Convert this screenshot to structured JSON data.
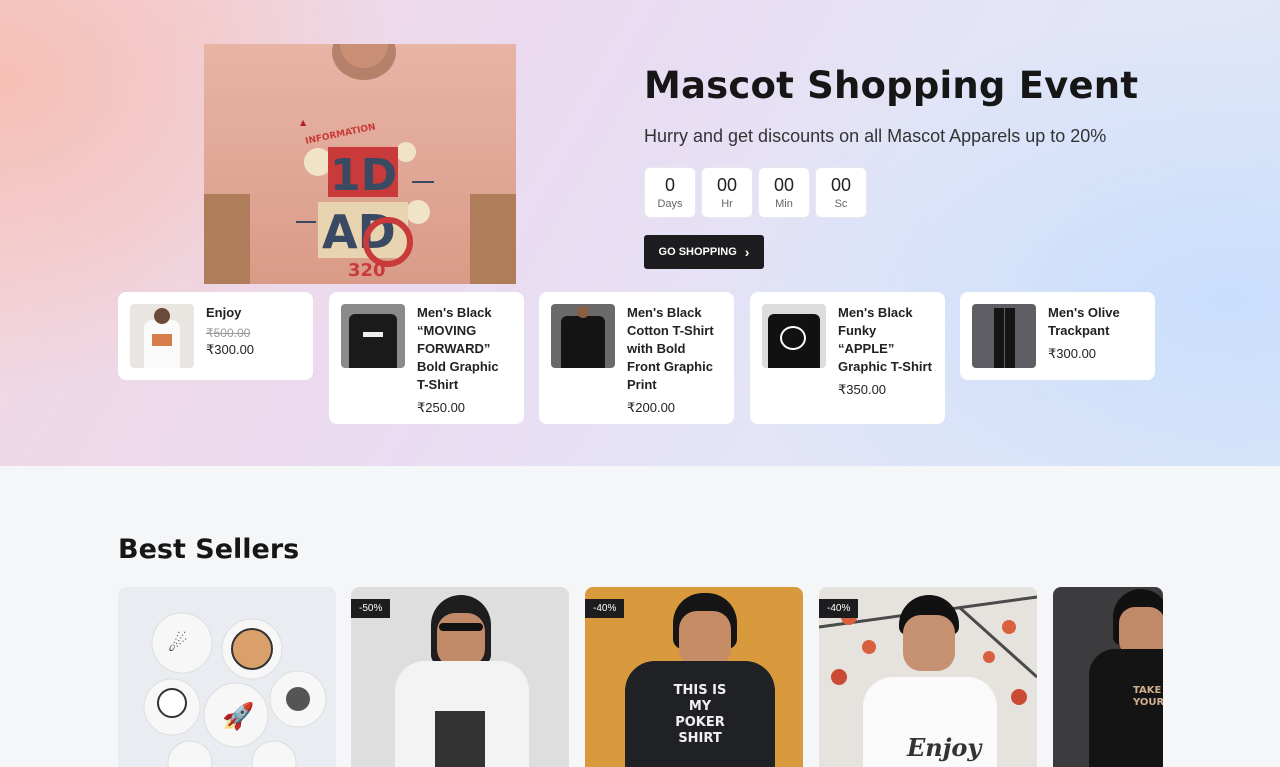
{
  "hero": {
    "title": "Mascot Shopping Event",
    "subtitle": "Hurry and get discounts on all Mascot Apparels up to 20%",
    "countdown": [
      {
        "value": "0",
        "label": "Days"
      },
      {
        "value": "00",
        "label": "Hr"
      },
      {
        "value": "00",
        "label": "Min"
      },
      {
        "value": "00",
        "label": "Sc"
      }
    ],
    "cta_label": "GO SHOPPING"
  },
  "products": [
    {
      "name": "Enjoy",
      "old_price": "₹500.00",
      "price": "₹300.00"
    },
    {
      "name": "Men's Black “MOVING FORWARD” Bold Graphic T-Shirt",
      "price": "₹250.00"
    },
    {
      "name": "Men's Black Cotton T-Shirt with Bold Front Graphic Print",
      "price": "₹200.00"
    },
    {
      "name": "Men's Black Funky “APPLE” Graphic T-Shirt",
      "price": "₹350.00"
    },
    {
      "name": "Men's Olive Trackpant",
      "price": "₹300.00"
    }
  ],
  "best_sellers": {
    "title": "Best Sellers",
    "badges": [
      "-50%",
      "-40%",
      "-40%"
    ]
  }
}
